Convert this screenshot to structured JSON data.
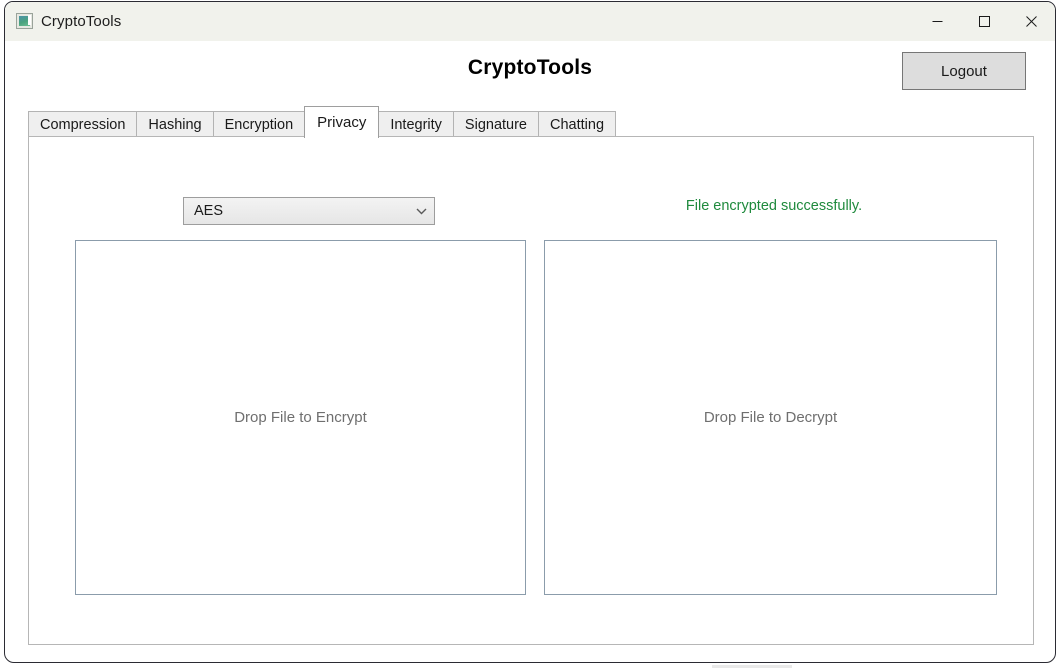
{
  "window": {
    "title": "CryptoTools",
    "icon": "app-window-icon",
    "controls": {
      "minimize": "minimize-icon",
      "maximize": "maximize-icon",
      "close": "close-icon"
    }
  },
  "header": {
    "app_title": "CryptoTools",
    "logout_label": "Logout"
  },
  "tabs": [
    {
      "label": "Compression",
      "active": false
    },
    {
      "label": "Hashing",
      "active": false
    },
    {
      "label": "Encryption",
      "active": false
    },
    {
      "label": "Privacy",
      "active": true
    },
    {
      "label": "Integrity",
      "active": false
    },
    {
      "label": "Signature",
      "active": false
    },
    {
      "label": "Chatting",
      "active": false
    }
  ],
  "privacy": {
    "algorithm": {
      "selected": "AES",
      "chevron": "chevron-down-icon"
    },
    "status_message": "File encrypted successfully.",
    "status_color": "#1f8a3d",
    "encrypt_zone_label": "Drop File to Encrypt",
    "decrypt_zone_label": "Drop File to Decrypt"
  },
  "colors": {
    "titlebar_bg": "#f1f2ec",
    "tab_inactive_bg": "#efefef",
    "tab_active_bg": "#ffffff",
    "button_bg": "#dddddd",
    "dropzone_border": "#8b9cab",
    "success_green": "#1f8a3d"
  }
}
